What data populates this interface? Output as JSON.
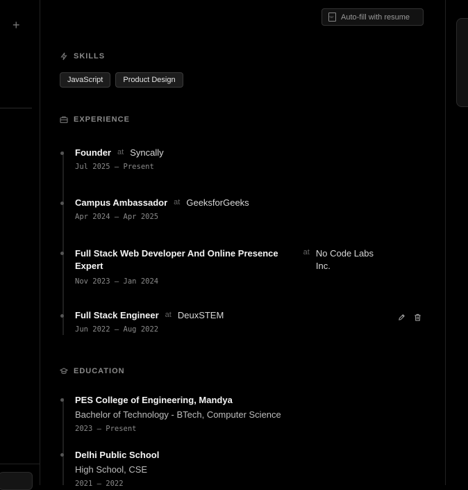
{
  "toolbar": {
    "autofill_label": "Auto-fill with resume"
  },
  "skills": {
    "title": "SKILLS",
    "items": [
      "JavaScript",
      "Product Design"
    ]
  },
  "experience": {
    "title": "EXPERIENCE",
    "at": "at",
    "items": [
      {
        "role": "Founder",
        "company": "Syncally",
        "dates": "Jul 2025 – Present"
      },
      {
        "role": "Campus Ambassador",
        "company": "GeeksforGeeks",
        "dates": "Apr 2024 – Apr 2025"
      },
      {
        "role": "Full Stack Web Developer And Online Presence Expert",
        "company": "No Code Labs Inc.",
        "dates": "Nov 2023 – Jan 2024"
      },
      {
        "role": "Full Stack Engineer",
        "company": "DeuxSTEM",
        "dates": "Jun 2022 – Aug 2022"
      }
    ]
  },
  "education": {
    "title": "EDUCATION",
    "items": [
      {
        "school": "PES College of Engineering, Mandya",
        "degree": "Bachelor of Technology - BTech, Computer Science",
        "dates": "2023 – Present"
      },
      {
        "school": "Delhi Public School",
        "degree": "High School, CSE",
        "dates": "2021 – 2022"
      }
    ]
  },
  "icons": [
    "plus-icon",
    "pdf-icon",
    "lightning-icon",
    "briefcase-icon",
    "graduation-cap-icon",
    "edit-icon",
    "trash-icon"
  ]
}
